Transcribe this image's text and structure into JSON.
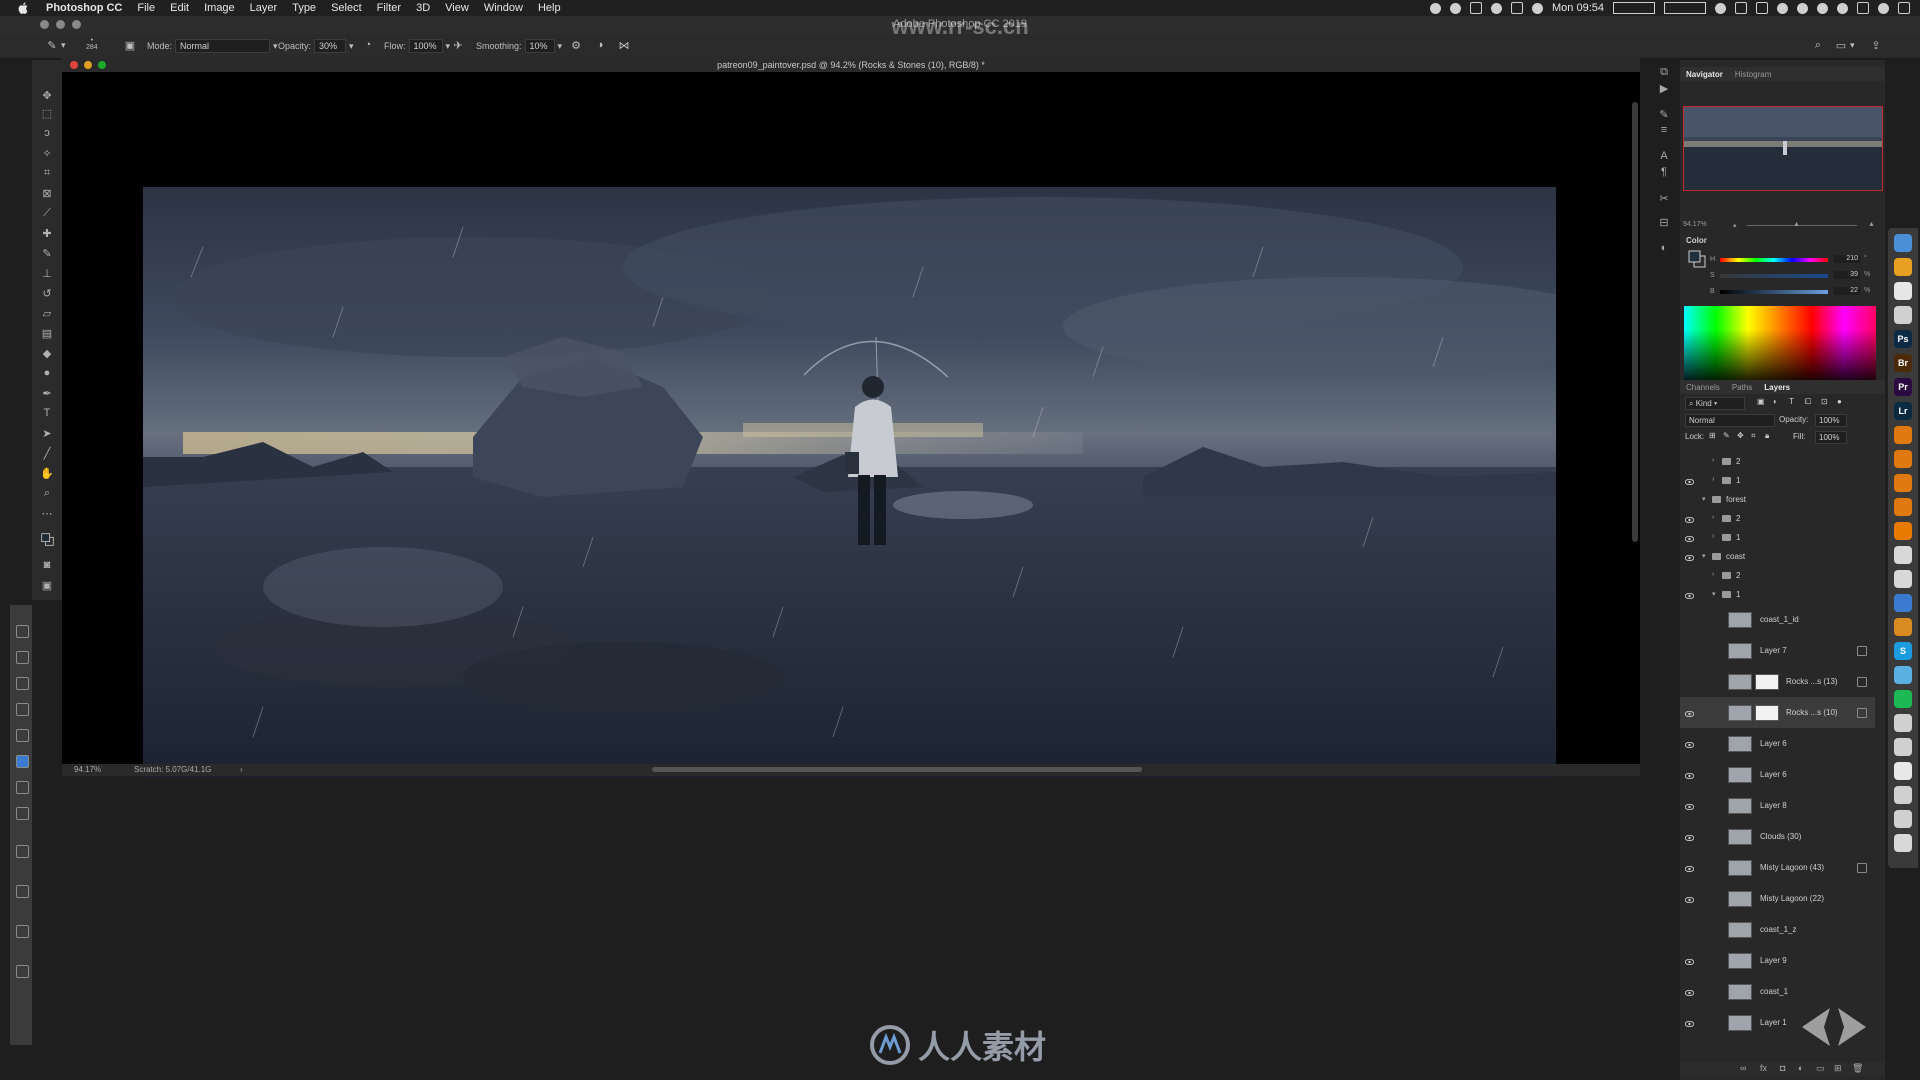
{
  "menubar": {
    "app_name": "Photoshop CC",
    "menus": [
      "File",
      "Edit",
      "Image",
      "Layer",
      "Type",
      "Select",
      "Filter",
      "3D",
      "View",
      "Window",
      "Help"
    ],
    "clock": "Mon 09:54"
  },
  "app_window": {
    "title": "Adobe Photoshop CC 2019"
  },
  "watermark": {
    "top": "www.rr-sc.cn",
    "bottom": "人人素材"
  },
  "options_bar": {
    "brush_size": "284",
    "mode_label": "Mode:",
    "mode_value": "Normal",
    "opacity_label": "Opacity:",
    "opacity_value": "30%",
    "flow_label": "Flow:",
    "flow_value": "100%",
    "smoothing_label": "Smoothing:",
    "smoothing_value": "10%"
  },
  "document": {
    "title": "patreon09_paintover.psd @ 94.2% (Rocks & Stones (10), RGB/8) *",
    "zoom": "94.17%",
    "scratch": "Scratch: 5.07G/41.1G"
  },
  "navigator": {
    "tabs": [
      "Navigator",
      "Histogram"
    ],
    "active_tab": "Navigator",
    "zoom": "94.17%"
  },
  "color_panel": {
    "label": "Color",
    "h_label": "H",
    "s_label": "S",
    "b_label": "B",
    "h_value": "210",
    "s_value": "39",
    "b_value": "22",
    "h_unit": "°",
    "s_unit": "%",
    "b_unit": "%"
  },
  "layers_panel": {
    "tabs": [
      "Channels",
      "Paths",
      "Layers"
    ],
    "active_tab": "Layers",
    "filter_kind": "Kind",
    "blend_mode": "Normal",
    "opacity_label": "Opacity:",
    "opacity_value": "100%",
    "lock_label": "Lock:",
    "fill_label": "Fill:",
    "fill_value": "100%",
    "layers": [
      {
        "name": "2",
        "type": "group",
        "indent": 2,
        "visible": false
      },
      {
        "name": "1",
        "type": "group",
        "indent": 2,
        "visible": true
      },
      {
        "name": "forest",
        "type": "group-open",
        "indent": 1,
        "visible": false
      },
      {
        "name": "2",
        "type": "group",
        "indent": 2,
        "visible": true
      },
      {
        "name": "1",
        "type": "group",
        "indent": 2,
        "visible": true
      },
      {
        "name": "coast",
        "type": "group-open",
        "indent": 1,
        "visible": true
      },
      {
        "name": "2",
        "type": "group",
        "indent": 2,
        "visible": false
      },
      {
        "name": "1",
        "type": "group-open",
        "indent": 2,
        "visible": true
      },
      {
        "name": "coast_1_id",
        "type": "layer",
        "visible": false
      },
      {
        "name": "Layer 7",
        "type": "layer",
        "visible": false,
        "fx": true
      },
      {
        "name": "Rocks ...s (13)",
        "type": "layer-mask",
        "visible": false,
        "fx": true
      },
      {
        "name": "Rocks ...s (10)",
        "type": "layer-mask",
        "visible": true,
        "fx": true,
        "selected": true
      },
      {
        "name": "Layer 6",
        "type": "layer",
        "visible": true
      },
      {
        "name": "Layer 6",
        "type": "layer",
        "visible": true
      },
      {
        "name": "Layer 8",
        "type": "layer",
        "visible": true
      },
      {
        "name": "Clouds (30)",
        "type": "layer",
        "visible": true
      },
      {
        "name": "Misty Lagoon (43)",
        "type": "layer",
        "visible": true,
        "fx": true
      },
      {
        "name": "Misty Lagoon (22)",
        "type": "layer",
        "visible": true
      },
      {
        "name": "coast_1_z",
        "type": "layer",
        "visible": false
      },
      {
        "name": "Layer 9",
        "type": "layer",
        "visible": true
      },
      {
        "name": "coast_1",
        "type": "layer",
        "visible": true
      },
      {
        "name": "Layer 1",
        "type": "layer",
        "visible": true
      }
    ]
  },
  "dock": [
    {
      "icon": "finder-icon",
      "label": "",
      "color": "#4a90d9"
    },
    {
      "icon": "chrome-icon",
      "label": "",
      "color": "#e8a020"
    },
    {
      "icon": "safari-icon",
      "label": "",
      "color": "#e6e6e6"
    },
    {
      "icon": "clock-icon",
      "label": "",
      "color": "#d0d0d0"
    },
    {
      "icon": "photoshop-icon",
      "label": "Ps",
      "color": "#0d2a45"
    },
    {
      "icon": "bridge-icon",
      "label": "Br",
      "color": "#4a2a08"
    },
    {
      "icon": "premiere-icon",
      "label": "Pr",
      "color": "#2a0a40"
    },
    {
      "icon": "lightroom-icon",
      "label": "Lr",
      "color": "#0a2a40"
    },
    {
      "icon": "blender-icon",
      "label": "",
      "color": "#e07a10"
    },
    {
      "icon": "blender-icon-2",
      "label": "",
      "color": "#e07a10"
    },
    {
      "icon": "blender-icon-3",
      "label": "",
      "color": "#e07a10"
    },
    {
      "icon": "blender-icon-4",
      "label": "",
      "color": "#e07a10"
    },
    {
      "icon": "houdini-icon",
      "label": "",
      "color": "#e87a00"
    },
    {
      "icon": "unity-icon",
      "label": "",
      "color": "#d8d8d8"
    },
    {
      "icon": "clock-icon-2",
      "label": "",
      "color": "#d8d8d8"
    },
    {
      "icon": "quicktime-icon",
      "label": "",
      "color": "#3a7ad0"
    },
    {
      "icon": "firefox-icon",
      "label": "",
      "color": "#d98a20"
    },
    {
      "icon": "skype-icon",
      "label": "S",
      "color": "#1d9be0"
    },
    {
      "icon": "arc-icon",
      "label": "",
      "color": "#5ab0e0"
    },
    {
      "icon": "spotify-icon",
      "label": "",
      "color": "#1db954"
    },
    {
      "icon": "pen-icon",
      "label": "",
      "color": "#d0d0d0"
    },
    {
      "icon": "script-icon",
      "label": "",
      "color": "#d0d0d0"
    },
    {
      "icon": "calendar-icon",
      "label": "",
      "color": "#e8e8e8"
    },
    {
      "icon": "camera-icon",
      "label": "",
      "color": "#d0d0d0"
    },
    {
      "icon": "preview-icon",
      "label": "",
      "color": "#d0d0d0"
    },
    {
      "icon": "trash-icon",
      "label": "",
      "color": "#d8d8d8"
    }
  ]
}
